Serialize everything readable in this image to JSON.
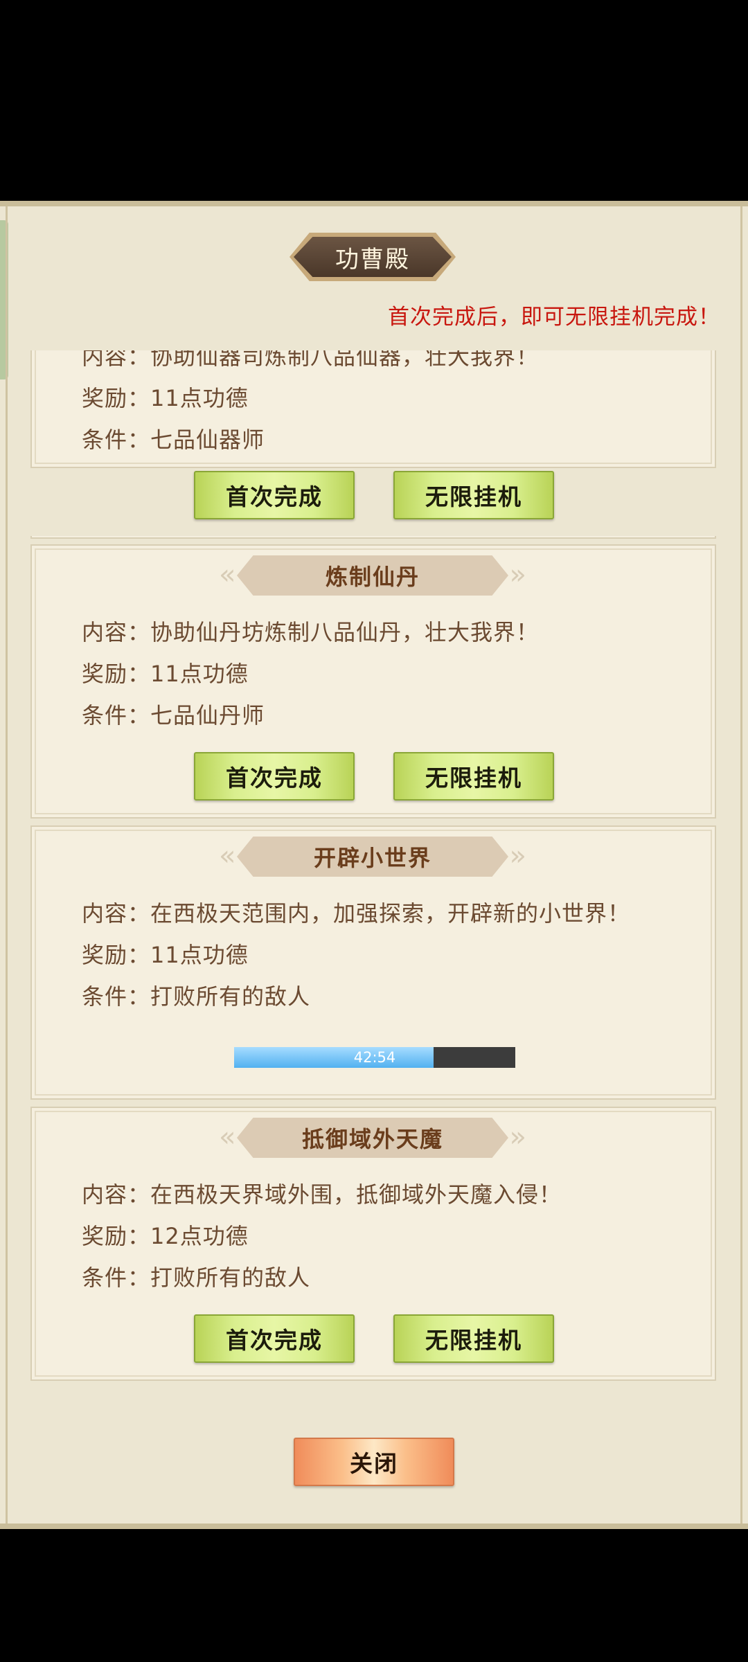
{
  "dialog": {
    "title": "功曹殿",
    "hint": "首次完成后，即可无限挂机完成！",
    "close_label": "关闭"
  },
  "tasks": [
    {
      "title": "",
      "content": "内容：协助仙器司炼制八品仙器，壮大我界！",
      "reward": "奖励：11点功德",
      "condition": "条件：七品仙器师",
      "first_label": "首次完成",
      "idle_label": "无限挂机"
    },
    {
      "title": "炼制仙丹",
      "content": "内容：协助仙丹坊炼制八品仙丹，壮大我界！",
      "reward": "奖励：11点功德",
      "condition": "条件：七品仙丹师",
      "first_label": "首次完成",
      "idle_label": "无限挂机"
    },
    {
      "title": "开辟小世界",
      "content": "内容：在西极天范围内，加强探索，开辟新的小世界！",
      "reward": "奖励：11点功德",
      "condition": "条件：打败所有的敌人",
      "timer": "42:54",
      "progress": 0.71
    },
    {
      "title": "抵御域外天魔",
      "content": "内容：在西极天界域外围，抵御域外天魔入侵！",
      "reward": "奖励：12点功德",
      "condition": "条件：打败所有的敌人",
      "first_label": "首次完成",
      "idle_label": "无限挂机"
    }
  ]
}
